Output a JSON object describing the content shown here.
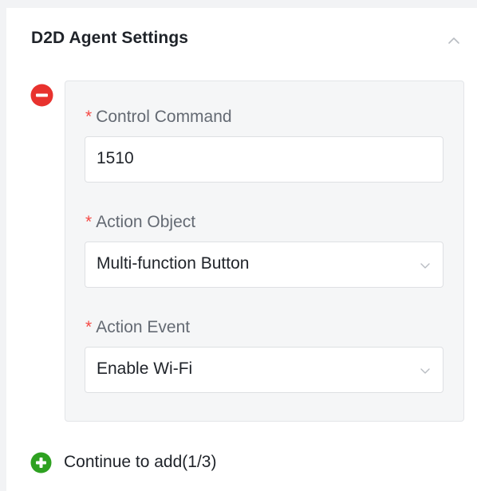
{
  "panel": {
    "title": "D2D Agent Settings",
    "collapse_icon": "chevron-up-icon"
  },
  "rule": {
    "remove_icon": "minus-circle-icon",
    "required_marker": "*",
    "control_command": {
      "label": "Control Command",
      "value": "1510"
    },
    "action_object": {
      "label": "Action Object",
      "value": "Multi-function Button",
      "dropdown_icon": "chevron-down-icon"
    },
    "action_event": {
      "label": "Action Event",
      "value": "Enable Wi-Fi",
      "dropdown_icon": "chevron-down-icon"
    }
  },
  "add": {
    "label": "Continue to add(1/3)",
    "icon": "plus-circle-icon"
  },
  "colors": {
    "remove": "#e8322e",
    "add": "#2ea121",
    "required": "#f54a45",
    "card_bg": "#f5f6f7"
  }
}
